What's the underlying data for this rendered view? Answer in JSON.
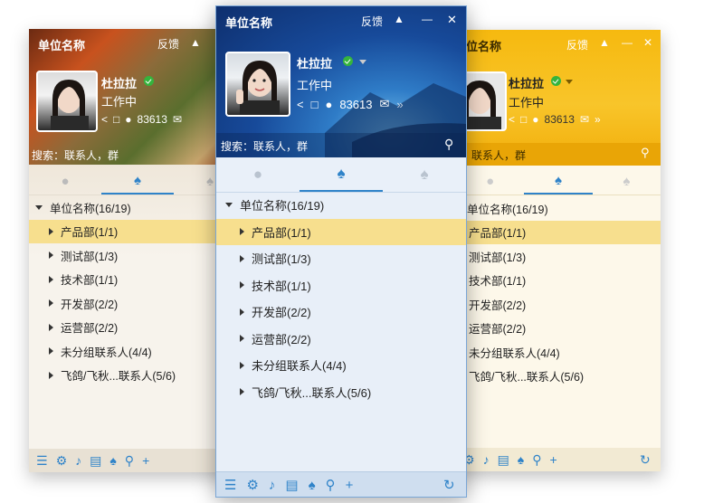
{
  "app": {
    "title": "单位名称",
    "feedback": "反馈",
    "minimize": "—",
    "close": "✕"
  },
  "user": {
    "name": "杜拉拉",
    "status": "工作中",
    "points": "83613"
  },
  "search": {
    "placeholder": "搜索：联系人，群"
  },
  "tree": {
    "root": "单位名称(16/19)",
    "groups": [
      {
        "label": "产品部(1/1)"
      },
      {
        "label": "测试部(1/3)"
      },
      {
        "label": "技术部(1/1)"
      },
      {
        "label": "开发部(2/2)"
      },
      {
        "label": "运营部(2/2)"
      },
      {
        "label": "未分组联系人(4/4)"
      },
      {
        "label": "飞鸽/飞秋...联系人(5/6)"
      }
    ]
  },
  "icons": {
    "tabs": [
      "chat-icon",
      "contacts-icon",
      "group-icon"
    ],
    "tools": [
      "share-icon",
      "message-icon",
      "piggy-bank-icon",
      "mail-icon",
      "more-icon"
    ],
    "footer": [
      "menu-icon",
      "settings-icon",
      "volume-icon",
      "file-icon",
      "add-contact-icon",
      "search-icon",
      "add-icon",
      "refresh-icon"
    ]
  },
  "themes": {
    "autumn": "#8a3d1c",
    "blue": "#1a4f99",
    "yellow": "#f5b50f",
    "selected_row": "#f7df8e"
  }
}
